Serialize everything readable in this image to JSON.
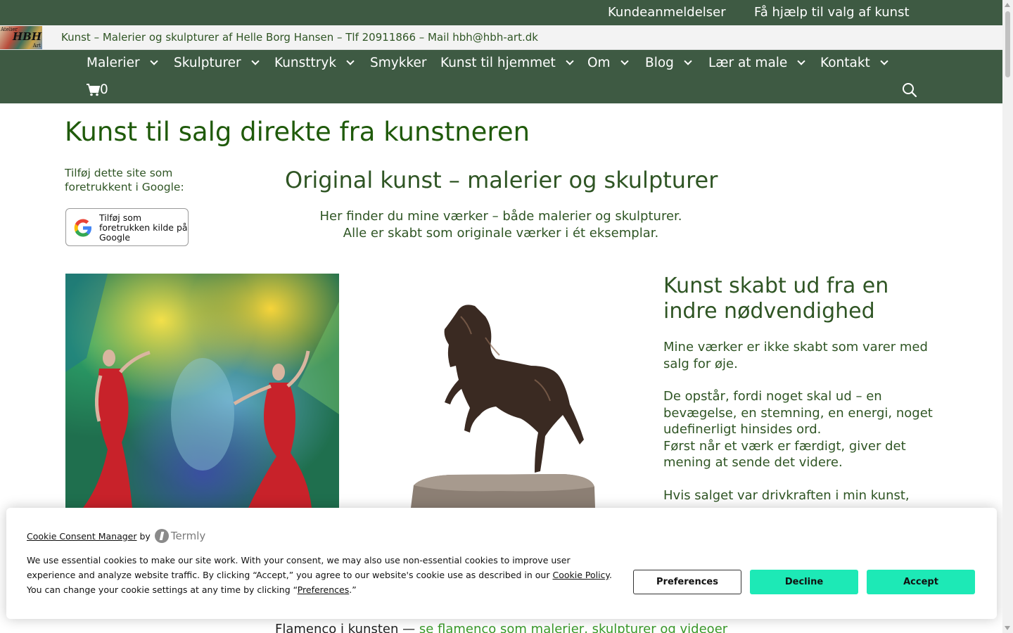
{
  "topbar": {
    "links": [
      "Kundeanmeldelser",
      "Få hjælp til valg af kunst"
    ]
  },
  "logo": {
    "line1": "Atelier",
    "line2": "HBH",
    "line3": "Art"
  },
  "tagline": "Kunst – Malerier og skulpturer af Helle Borg Hansen – Tlf 20911866 – Mail hbh@hbh-art.dk",
  "nav": {
    "items": [
      "Malerier",
      "Skulpturer",
      "Kunsttryk",
      "Smykker",
      "Kunst til hjemmet",
      "Om",
      "Blog",
      "Lær at male",
      "Kontakt"
    ],
    "cart_count": "0"
  },
  "page": {
    "title": "Kunst til salg direkte fra kunstneren",
    "google_pref_label": "Tilføj dette site som foretrukkent i Google:",
    "google_button_text": "Tilføj som foretrukken kilde på Google",
    "section_title": "Original kunst – malerier og skulpturer",
    "intro_line1": "Her finder du mine værker – både malerier og skulpturer.",
    "intro_line2": "Alle er skabt som originale værker i ét eksemplar.",
    "right_title": "Kunst skabt ud fra en indre nødvendighed",
    "right_p1": "Mine værker er ikke skabt som varer med salg for øje.",
    "right_p2a": "De opstår, fordi noget skal ud – en bevægelse, en stemning, en energi, noget udefinerligt hinsides ord.",
    "right_p2b": "Først når et værk er færdigt, giver det mening at sende det videre.",
    "right_p3": "Hvis salget var drivkraften i min kunst,",
    "bottom_prefix": "Flamenco i kunsten —",
    "bottom_link": "se flamenco som malerier, skulpturer og videoer"
  },
  "cookie": {
    "title_link": "Cookie Consent Manager",
    "title_by": "by",
    "brand": "Termly",
    "body_before": "We use essential cookies to make our site work. With your consent, we may also use non-essential cookies to improve user experience and analyze website traffic. By clicking “Accept,” you agree to our website's cookie use as described in our",
    "policy_link": "Cookie Policy",
    "body_middle": ". You can change your cookie settings at any time by clicking “",
    "pref_link": "Preferences",
    "body_end": ".”",
    "buttons": {
      "preferences": "Preferences",
      "decline": "Decline",
      "accept": "Accept"
    }
  },
  "colors": {
    "nav_bg": "#3e5a43",
    "text_green": "#2f5524",
    "title_green": "#1f5a0a",
    "accept_btn": "#1de9b6"
  }
}
